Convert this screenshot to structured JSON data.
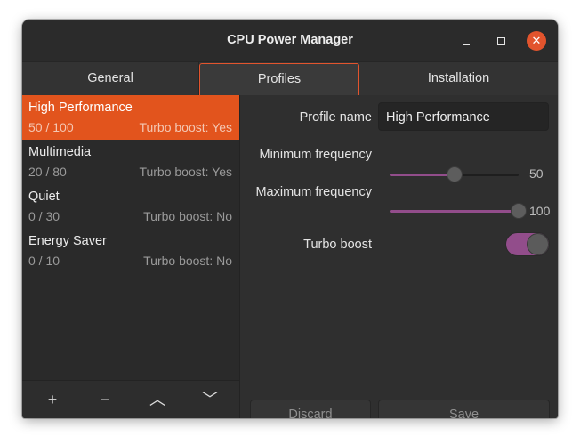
{
  "window": {
    "title": "CPU Power Manager",
    "controls": {
      "minimize": "minimize-icon",
      "maximize": "maximize-icon",
      "close": "close-icon",
      "close_glyph": "✕"
    }
  },
  "tabs": [
    {
      "label": "General",
      "selected": false
    },
    {
      "label": "Profiles",
      "selected": true
    },
    {
      "label": "Installation",
      "selected": false
    }
  ],
  "profiles": [
    {
      "name": "High Performance",
      "range": "50 / 100",
      "turbo": "Turbo boost: Yes",
      "selected": true
    },
    {
      "name": "Multimedia",
      "range": "20 / 80",
      "turbo": "Turbo boost: Yes",
      "selected": false
    },
    {
      "name": "Quiet",
      "range": "0 / 30",
      "turbo": "Turbo boost: No",
      "selected": false
    },
    {
      "name": "Energy Saver",
      "range": "0 / 10",
      "turbo": "Turbo boost: No",
      "selected": false
    }
  ],
  "sidebar_toolbar": {
    "add": "+",
    "remove": "−",
    "up": "︿",
    "down": "﹀"
  },
  "form": {
    "profile_name_label": "Profile name",
    "profile_name_value": "High Performance",
    "min_freq_label": "Minimum frequency",
    "min_freq_value": "50",
    "min_freq_fraction": 0.5,
    "max_freq_label": "Maximum frequency",
    "max_freq_value": "100",
    "max_freq_fraction": 1.0,
    "turbo_label": "Turbo boost",
    "turbo_on": true
  },
  "actions": {
    "discard": "Discard",
    "save": "Save"
  },
  "colors": {
    "accent": "#E2541D",
    "close_button": "#E2542D",
    "slider_fill": "#924D8B"
  }
}
